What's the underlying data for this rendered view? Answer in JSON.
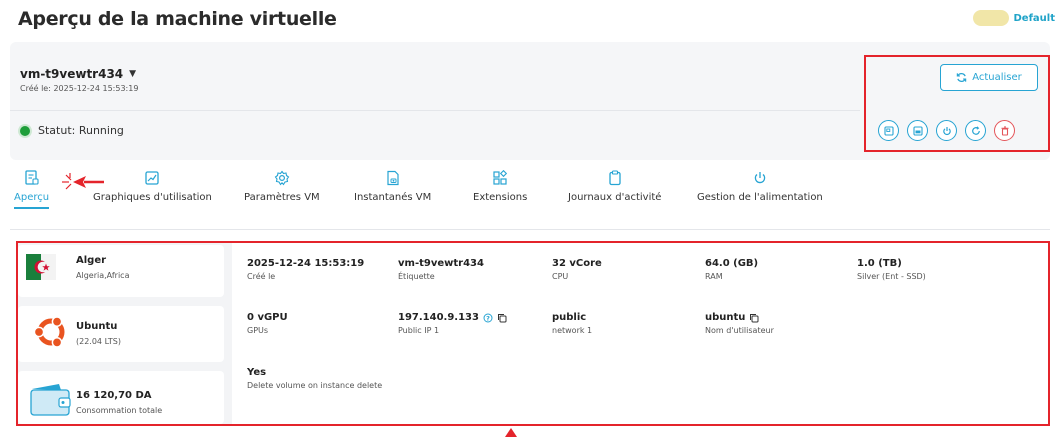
{
  "header": {
    "title": "Aperçu de la machine virtuelle",
    "profile_label": "Default"
  },
  "vm": {
    "name": "vm-t9vewtr434",
    "created": "Créé le: 2025-12-24 15:53:19",
    "status": "Statut: Running"
  },
  "actions": {
    "refresh_label": "Actualiser"
  },
  "tabs": [
    {
      "label": "Aperçu",
      "icon": "overview-icon"
    },
    {
      "label": "Graphiques d'utilisation",
      "icon": "chart-icon"
    },
    {
      "label": "Paramètres VM",
      "icon": "settings-icon"
    },
    {
      "label": "Instantanés VM",
      "icon": "snapshot-icon"
    },
    {
      "label": "Extensions",
      "icon": "extensions-icon"
    },
    {
      "label": "Journaux d'activité",
      "icon": "clipboard-icon"
    },
    {
      "label": "Gestion de l'alimentation",
      "icon": "power-icon"
    }
  ],
  "sidebar": {
    "location": {
      "city": "Alger",
      "region": "Algeria,Africa"
    },
    "os": {
      "name": "Ubuntu",
      "version": "(22.04 LTS)"
    },
    "consumption": {
      "amount": "16 120,70 DA",
      "label": "Consommation totale"
    }
  },
  "details": [
    {
      "value": "2025-12-24 15:53:19",
      "label": "Créé le"
    },
    {
      "value": "vm-t9vewtr434",
      "label": "Étiquette"
    },
    {
      "value": "32 vCore",
      "label": "CPU"
    },
    {
      "value": "64.0 (GB)",
      "label": "RAM"
    },
    {
      "value": "1.0 (TB)",
      "label": "Silver (Ent - SSD)"
    },
    {
      "value": "0 vGPU",
      "label": "GPUs"
    },
    {
      "value": "197.140.9.133",
      "label": "Public IP 1"
    },
    {
      "value": "public",
      "label": "network 1"
    },
    {
      "value": "ubuntu",
      "label": "Nom d'utilisateur"
    },
    {
      "value": "Yes",
      "label": "Delete volume on instance delete"
    }
  ],
  "colors": {
    "accent": "#27a4d3",
    "highlight": "#e4242b",
    "running": "#1e9e3a"
  }
}
